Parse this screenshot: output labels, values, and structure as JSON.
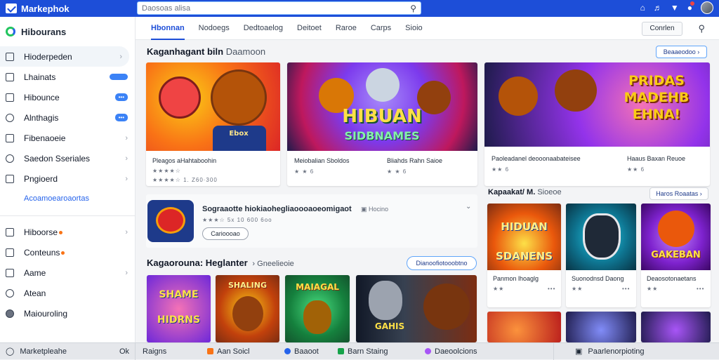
{
  "app": {
    "title": "Markephok"
  },
  "search": {
    "placeholder": "Daosoas alisa"
  },
  "sidebar": {
    "header": "Hibourans",
    "items": [
      {
        "label": "Hioderpeden",
        "icon": "store-icon"
      },
      {
        "label": "Lhainats",
        "icon": "list-icon"
      },
      {
        "label": "Hibounce",
        "icon": "list-icon",
        "badge": "•••"
      },
      {
        "label": "Alnthagis",
        "icon": "tag-icon",
        "badge": "•••"
      },
      {
        "label": "Fibenaoeie",
        "icon": "doc-icon"
      },
      {
        "label": "Saedon Sseriales",
        "icon": "gear-icon"
      },
      {
        "label": "Pngioerd",
        "icon": "doc-icon"
      }
    ],
    "link": "Acoamoearoaortas",
    "items2": [
      {
        "label": "Hiboorse",
        "icon": "list-icon"
      },
      {
        "label": "Conteuns",
        "icon": "home-icon"
      },
      {
        "label": "Aame",
        "icon": "check-icon"
      },
      {
        "label": "Atean",
        "icon": "chat-icon"
      },
      {
        "label": "Maiouroling",
        "icon": "user-icon"
      }
    ]
  },
  "tabs": [
    "Hbonnan",
    "Nodoegs",
    "Dedtoaelog",
    "Deitoet",
    "Raroe",
    "Carps",
    "Sioio"
  ],
  "tab_button": "Conrlen",
  "featured": {
    "title": "Kaganhagant biln",
    "subtitle": "Daamoon",
    "button": "Beaaeodoo",
    "cards": [
      {
        "caption": "Pleagos aHahtaboohin",
        "stars": "★★★★☆",
        "meta": "★★★★☆ 1.  Z60·300"
      },
      {
        "caption": "Meiobalian Sboldos",
        "stars": "★ ★ 6",
        "caption2": "Bliahds Rahn Saioe",
        "stars2": "★ ★ 6"
      },
      {
        "caption": "Paoleadanel deooonaabateisee",
        "stars": "★★ 6",
        "caption2": "Haaus Baxan Reuoe",
        "stars2": "★★ 6"
      }
    ],
    "art_text": {
      "card1": "Ebox",
      "card2a": "HIBUAN",
      "card2b": "SIDBNAMES",
      "card3": "PRIDAS MADEHB EHNA!"
    }
  },
  "app_row": {
    "title": "Sograaotte hiokiaohegliaoooaoeomigaot",
    "category": "Hocino",
    "stars": "★★★☆ 5x  10 600 6oo",
    "button": "Carioooao"
  },
  "side_section": {
    "title": "Kapaakat/ M.",
    "subtitle": "Sioeoe",
    "button": "Haros Roaatas",
    "cards": [
      {
        "caption": "Panmon lhoaglg",
        "art": "HIDUAN SDANENS"
      },
      {
        "caption": "Suonodnsd Daong",
        "art": ""
      },
      {
        "caption": "Deaosotonaetans",
        "art": "GAKEBAN"
      }
    ]
  },
  "bottom_section": {
    "title": "Kagaorouna: Heglanter",
    "subtitle": "Gneelieoie",
    "button": "Dianoofiotooobtno",
    "art_text": [
      "SHAME HIDRNS",
      "SHALING",
      "MAIAGAL",
      "GAHIS"
    ]
  },
  "statusbar": {
    "left": "Marketpleahe",
    "left_short": "Ok",
    "items": [
      {
        "label": "Raigns",
        "color": ""
      },
      {
        "label": "Aan Soicl",
        "color": "#f97316"
      },
      {
        "label": "Baaoot",
        "color": "#2563eb"
      },
      {
        "label": "Barn Staing",
        "color": "#16a34a"
      },
      {
        "label": "Daeoolcions",
        "color": "#a855f7"
      }
    ],
    "right": "Paarlenorpioting"
  },
  "colors": {
    "primary": "#1d4ed8",
    "accent": "#3b82f6"
  }
}
